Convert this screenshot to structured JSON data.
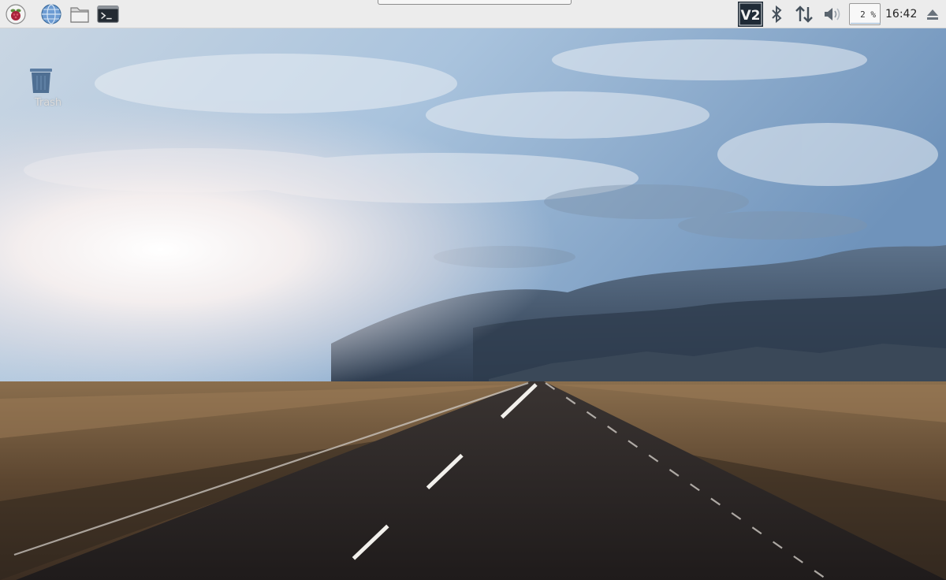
{
  "taskbar": {
    "launchers": [
      {
        "icon": "raspberry-menu-icon"
      },
      {
        "icon": "web-browser-globe-icon"
      },
      {
        "icon": "file-manager-folder-icon"
      },
      {
        "icon": "terminal-icon"
      }
    ],
    "tray": {
      "vnc_label": "V2",
      "bluetooth_icon": "bluetooth-icon",
      "network_icon": "network-arrows-icon",
      "volume_icon": "volume-speaker-icon",
      "cpu_usage_text": "2 %",
      "cpu_usage_fraction": 0.02,
      "clock": "16:42",
      "eject_icon": "eject-icon"
    }
  },
  "desktop": {
    "icons": [
      {
        "label": "Trash",
        "icon": "trash-icon"
      }
    ],
    "wallpaper": "road-landscape"
  },
  "colors": {
    "taskbar_bg": "#ececec",
    "vnc_bg": "#1f2a36",
    "sky_light": "#f6efee",
    "sky_blue": "#8fb2d6",
    "storm_dark": "#2e3c4e",
    "field": "#6b5236",
    "road": "#262120"
  }
}
